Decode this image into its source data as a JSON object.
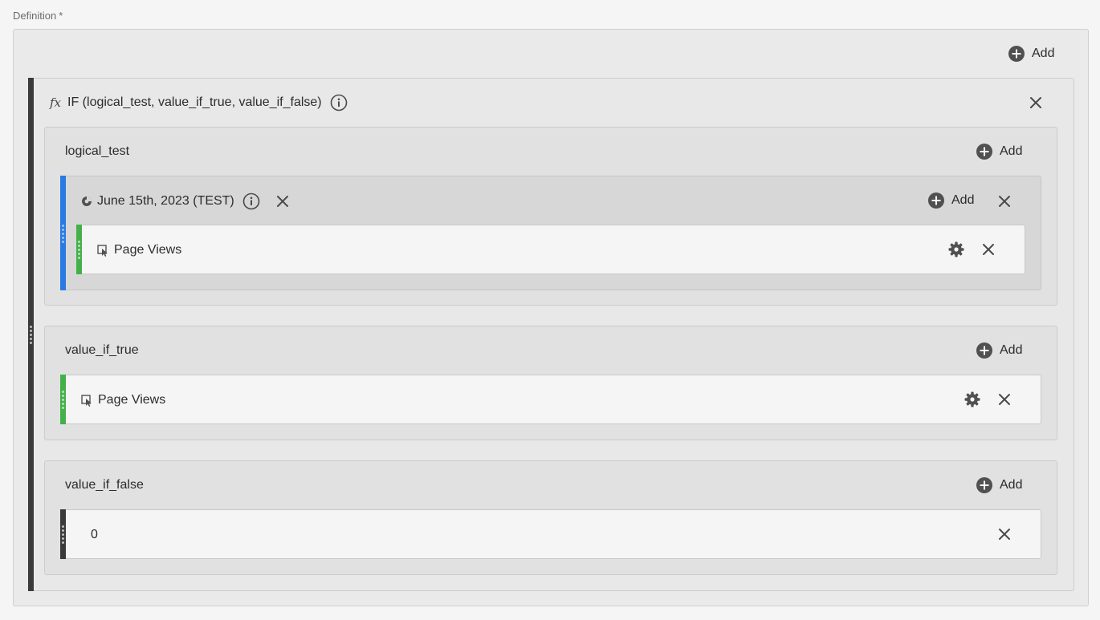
{
  "field": {
    "label": "Definition",
    "required_mark": "*"
  },
  "definition": {
    "add_label": "Add"
  },
  "function": {
    "signature": "IF (logical_test, value_if_true, value_if_false)",
    "fx_symbol": "fx"
  },
  "sections": {
    "logical_test": {
      "label": "logical_test",
      "add_label": "Add",
      "segment": {
        "name": "June 15th, 2023 (TEST)",
        "add_label": "Add",
        "metric": {
          "name": "Page Views"
        }
      }
    },
    "value_if_true": {
      "label": "value_if_true",
      "add_label": "Add",
      "metric": {
        "name": "Page Views"
      }
    },
    "value_if_false": {
      "label": "value_if_false",
      "add_label": "Add",
      "static_value": "0"
    }
  },
  "colors": {
    "segment_accent": "#2a7ae4",
    "metric_accent": "#43b04a",
    "function_accent": "#3a3a3a"
  },
  "icons": [
    "add-circle-icon",
    "info-icon",
    "close-icon",
    "gear-icon",
    "segment-icon",
    "metric-icon",
    "fx-icon",
    "drag-handle-icon"
  ]
}
